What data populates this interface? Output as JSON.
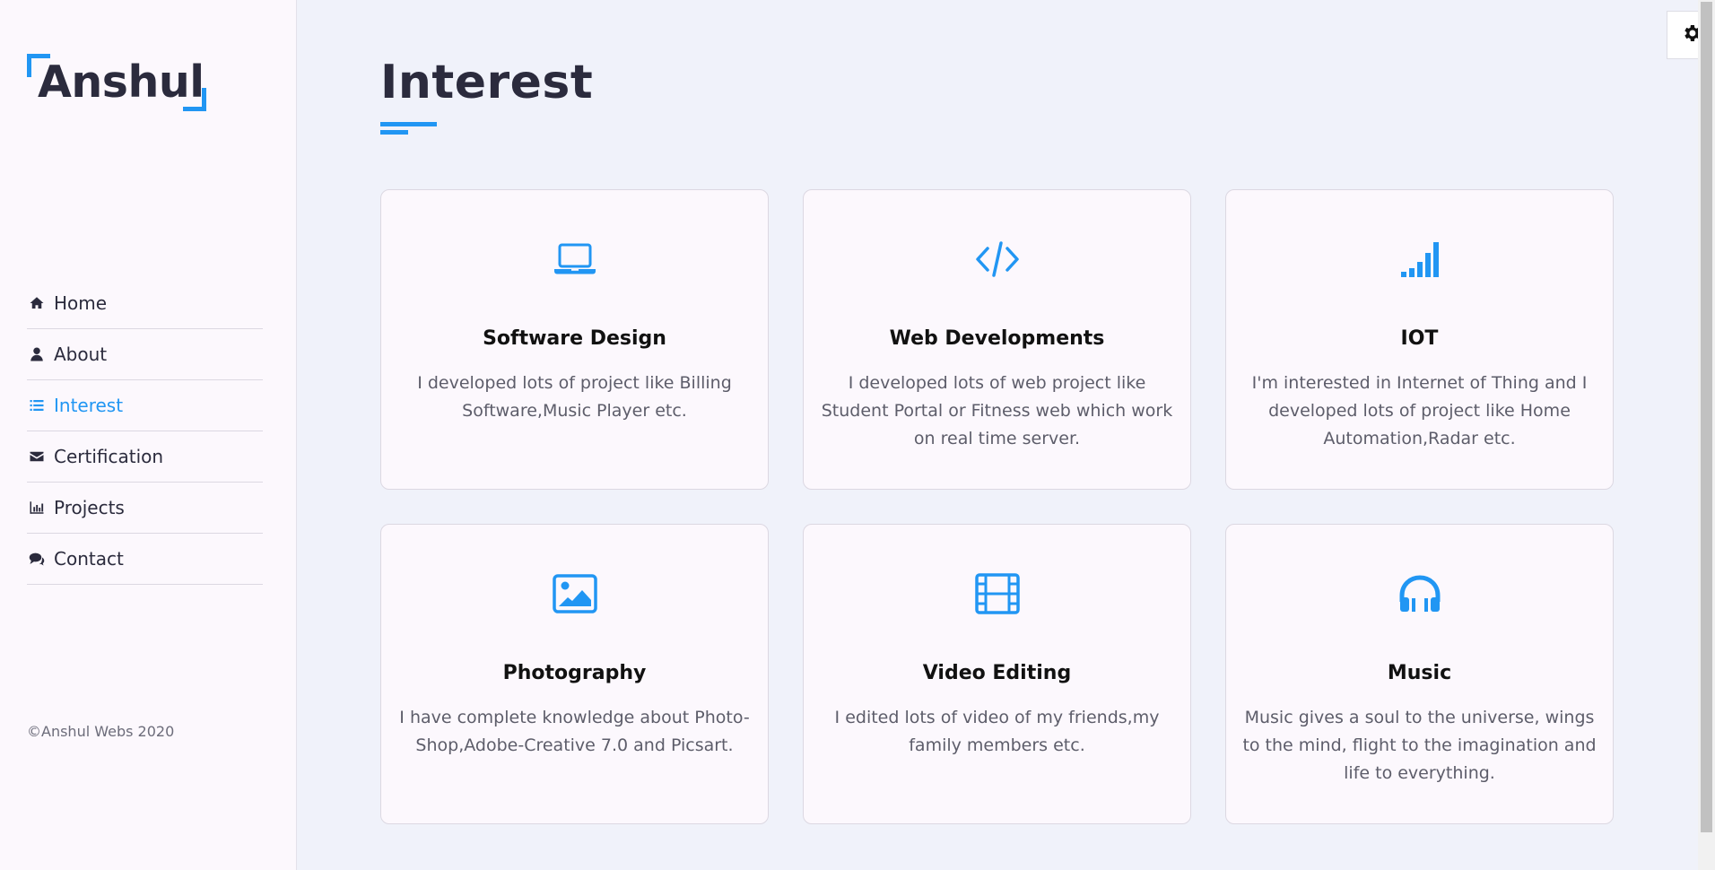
{
  "brand": {
    "name": "Anshul",
    "accent": "#2196f3"
  },
  "sidebar": {
    "items": [
      {
        "label": "Home",
        "icon": "home-icon"
      },
      {
        "label": "About",
        "icon": "user-icon"
      },
      {
        "label": "Interest",
        "icon": "list-icon",
        "active": true
      },
      {
        "label": "Certification",
        "icon": "envelope-icon"
      },
      {
        "label": "Projects",
        "icon": "bar-chart-icon"
      },
      {
        "label": "Contact",
        "icon": "comments-icon"
      }
    ],
    "copyright": "©Anshul Webs 2020"
  },
  "main": {
    "title": "Interest",
    "cards": [
      {
        "title": "Software Design",
        "icon": "laptop-icon",
        "text": "I developed lots of project like Billing Software,Music Player etc."
      },
      {
        "title": "Web Developments",
        "icon": "code-icon",
        "text": "I developed lots of web project like Student Portal or Fitness web which work on real time server."
      },
      {
        "title": "IOT",
        "icon": "signal-icon",
        "text": "I'm interested in Internet of Thing and I developed lots of project like Home Automation,Radar etc."
      },
      {
        "title": "Photography",
        "icon": "image-icon",
        "text": "I have complete knowledge about Photo-Shop,Adobe-Creative 7.0 and Picsart."
      },
      {
        "title": "Video Editing",
        "icon": "film-icon",
        "text": "I edited lots of video of my friends,my family members etc."
      },
      {
        "title": "Music",
        "icon": "headphones-icon",
        "text": "Music gives a soul to the universe, wings to the mind, flight to the imagination and life to everything."
      }
    ]
  },
  "settings": {
    "icon": "gear-icon"
  }
}
